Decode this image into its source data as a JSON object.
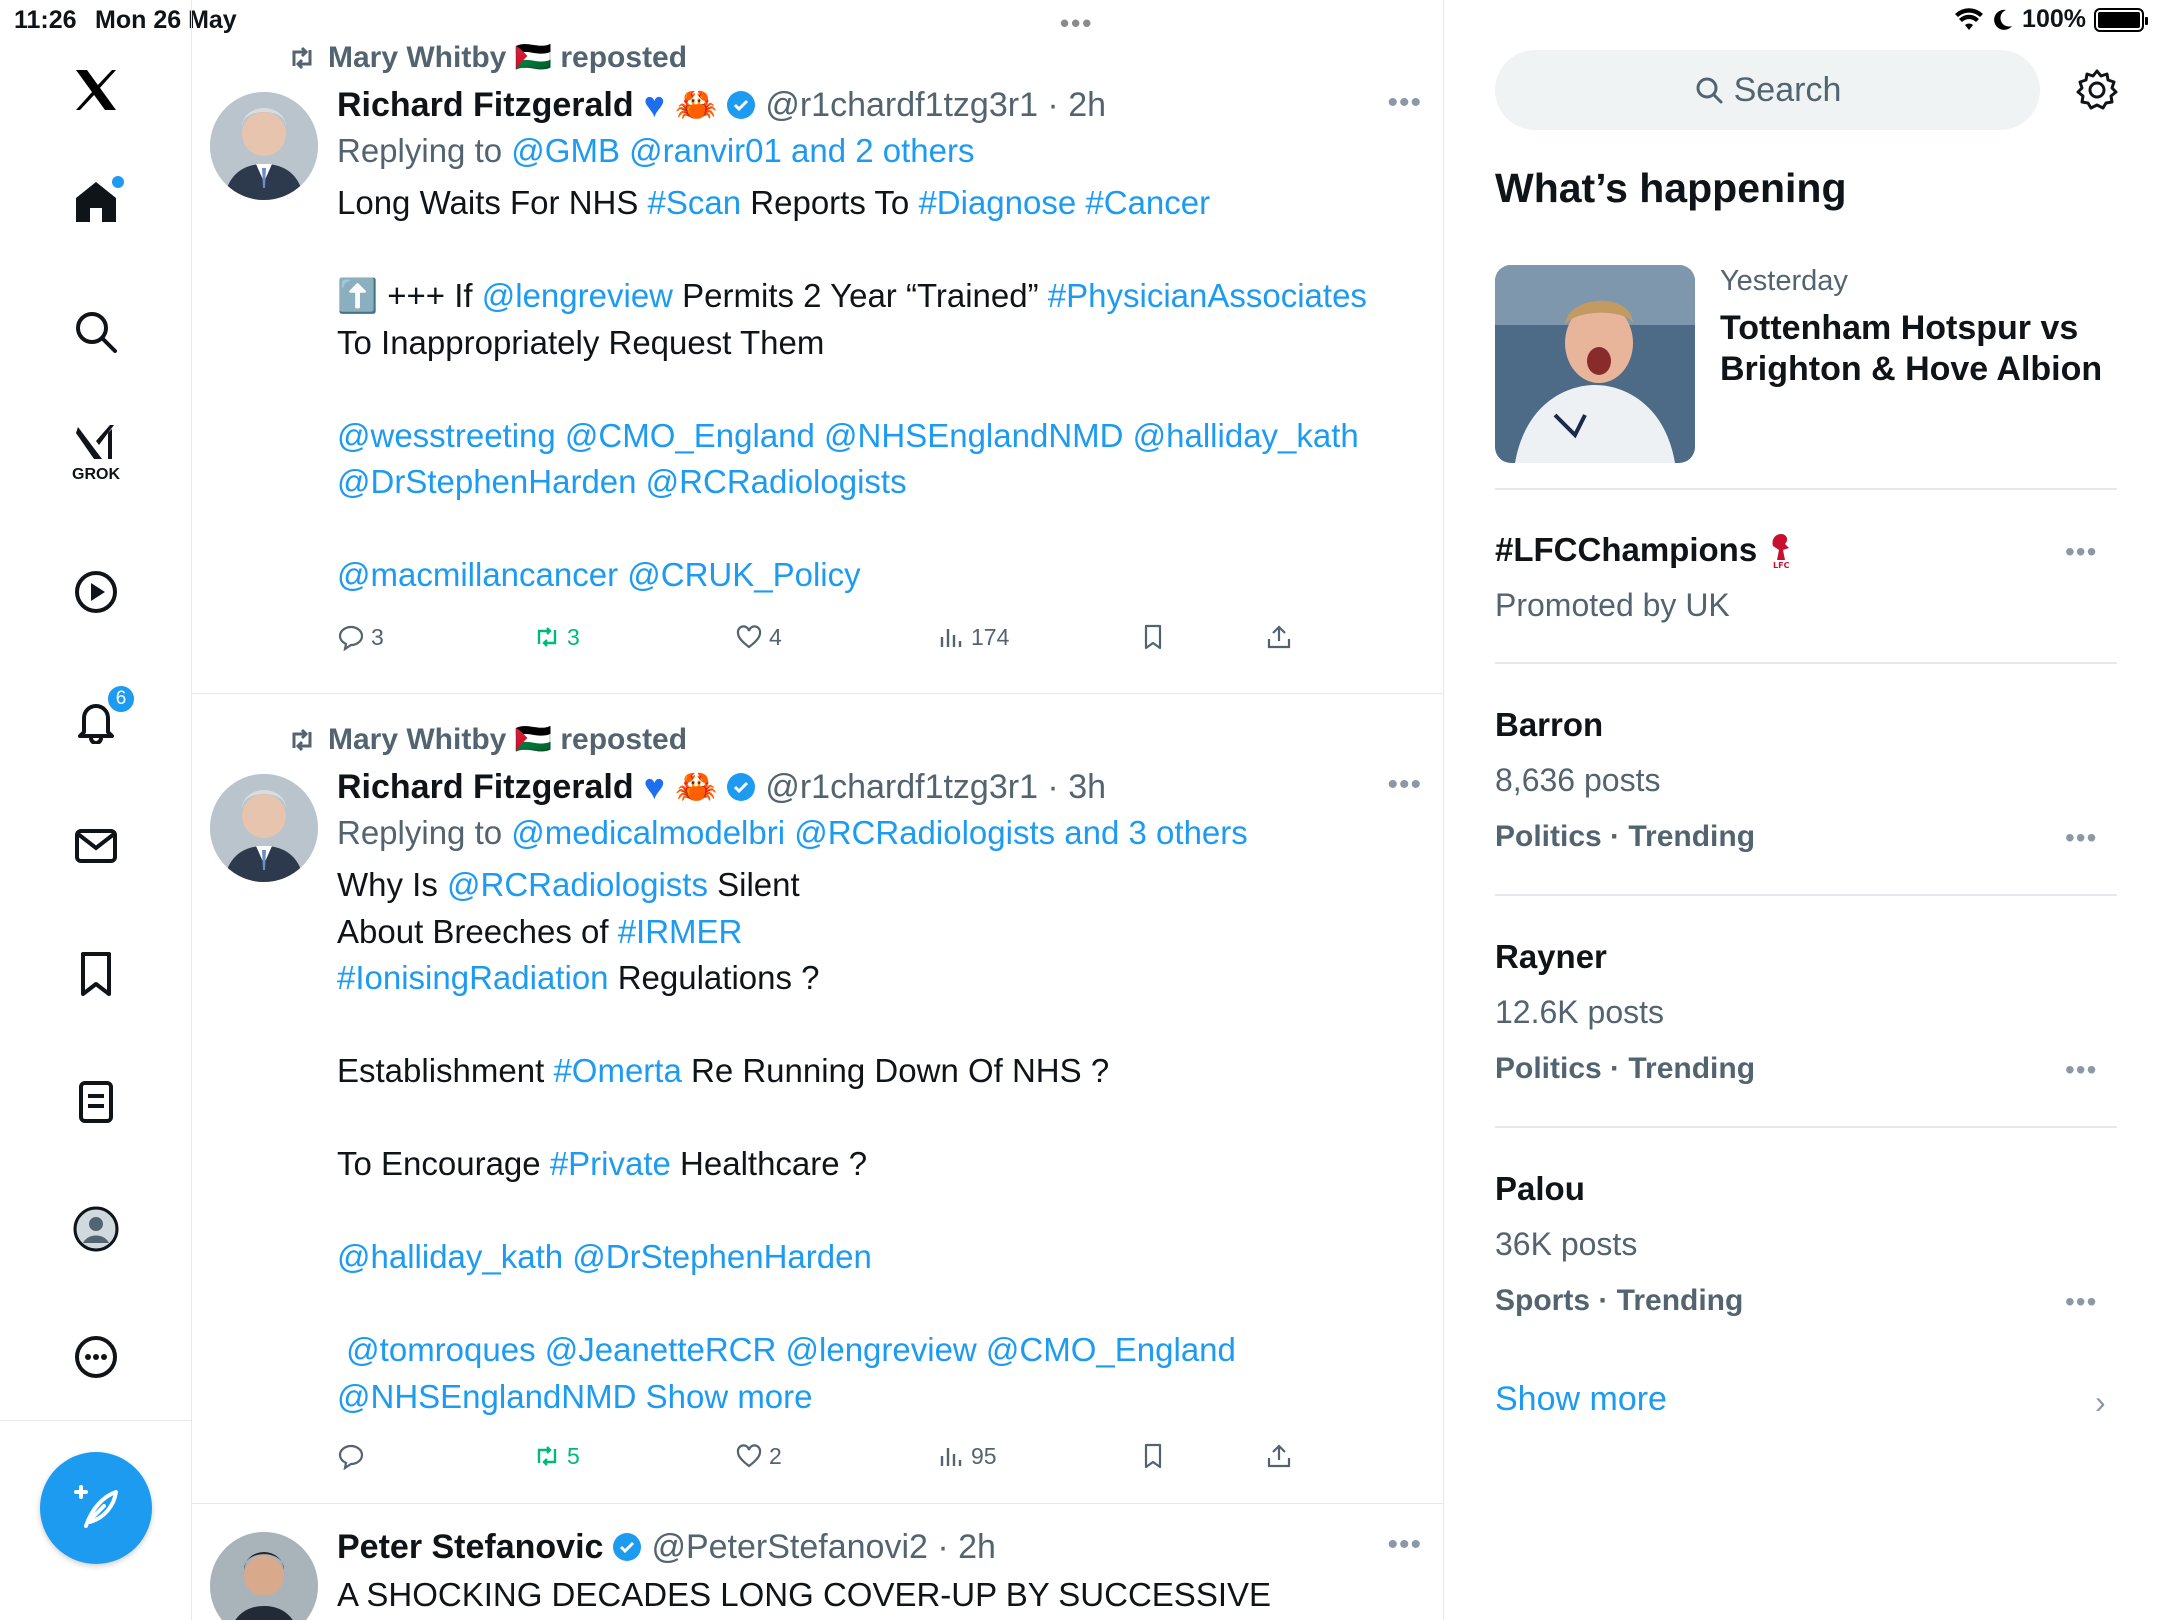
{
  "status": {
    "time": "11:26",
    "date": "Mon 26 May",
    "battery": "100%"
  },
  "nav": {
    "grok_label": "GROK",
    "notifications_count": "6"
  },
  "tweets": [
    {
      "repost_by": "Mary Whitby 🇵🇸 reposted",
      "name": "Richard Fitzgerald",
      "handle": "@r1chardf1tzg3r1 · 2h",
      "reply_prefix": "Replying to",
      "reply_to": "@GMB @ranvir01 and 2 others",
      "stats": {
        "replies": "3",
        "reposts": "3",
        "likes": "4",
        "views": "174"
      }
    },
    {
      "repost_by": "Mary Whitby 🇵🇸 reposted",
      "name": "Richard Fitzgerald",
      "handle": "@r1chardf1tzg3r1 · 3h",
      "reply_prefix": "Replying to",
      "reply_to": "@medicalmodelbri @RCRadiologists and 3 others",
      "stats": {
        "replies": "",
        "reposts": "5",
        "likes": "2",
        "views": "95"
      }
    },
    {
      "name": "Peter Stefanovic",
      "handle": "@PeterStefanovi2 · 2h",
      "text": "A SHOCKING DECADES LONG COVER-UP BY SUCCESSIVE"
    }
  ],
  "tweet1_text": {
    "l1a": "Long Waits For NHS ",
    "l1b": "#Scan",
    "l1c": " Reports To ",
    "l1d": "#Diagnose #Cancer",
    "l2a": "⬆️ +++ If ",
    "l2b": "@lengreview",
    "l2c": " Permits 2 Year “Trained” ",
    "l2d": "#PhysicianAssociates",
    "l3": "To Inappropriately Request Them",
    "l4": "@wesstreeting @CMO_England @NHSEnglandNMD @halliday_kath",
    "l5": "@DrStephenHarden @RCRadiologists",
    "l6": "@macmillancancer @CRUK_Policy"
  },
  "tweet2_text": {
    "l1a": "Why Is ",
    "l1b": "@RCRadiologists",
    "l1c": " Silent",
    "l2a": "About Breeches of ",
    "l2b": "#IRMER",
    "l3a": "#IonisingRadiation",
    "l3b": " Regulations ?",
    "l4a": "Establishment ",
    "l4b": "#Omerta",
    "l4c": " Re Running Down Of NHS ?",
    "l5a": "To Encourage ",
    "l5b": "#Private",
    "l5c": " Healthcare ?",
    "l6": "@halliday_kath @DrStephenHarden",
    "l7": " @tomroques @JeanetteRCR @lengreview @CMO_England",
    "l8a": "@NHSEnglandNMD",
    "l8b": " Show more"
  },
  "right": {
    "search_placeholder": "Search",
    "section_title": "What’s happening",
    "featured": {
      "meta": "Yesterday",
      "headline": "Tottenham Hotspur vs Brighton & Hove Albion"
    },
    "promoted": {
      "name": "#LFCChampions",
      "sub": "Promoted by UK"
    },
    "trends": [
      {
        "name": "Barron",
        "posts": "8,636 posts",
        "category": "Politics · Trending"
      },
      {
        "name": "Rayner",
        "posts": "12.6K posts",
        "category": "Politics · Trending"
      },
      {
        "name": "Palou",
        "posts": "36K posts",
        "category": "Sports · Trending"
      }
    ],
    "show_more": "Show more"
  },
  "colors": {
    "accent": "#1d9bf0",
    "repost_green": "#00ba7c",
    "muted": "#536471"
  }
}
